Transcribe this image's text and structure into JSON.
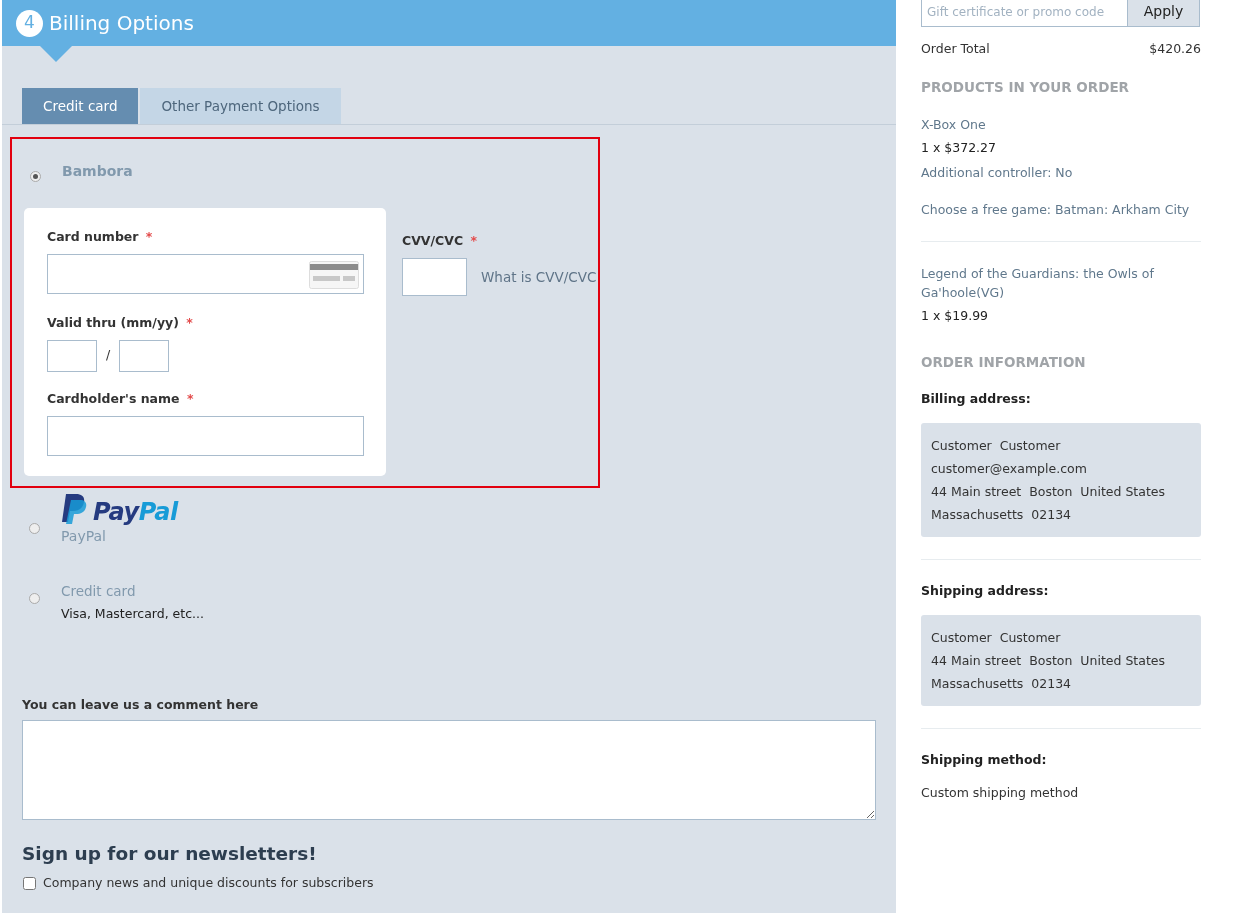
{
  "step": {
    "number": "4",
    "title": "Billing Options"
  },
  "tabs": [
    {
      "label": "Credit card",
      "selected": true
    },
    {
      "label": "Other Payment Options",
      "selected": false
    }
  ],
  "payment_methods": [
    {
      "kind": "form",
      "name": "Bambora",
      "selected": true,
      "highlighted": true,
      "card_number": {
        "label": "Card number",
        "required_mark": "*"
      },
      "valid_thru": {
        "label": "Valid thru (mm/yy)",
        "required_mark": "*",
        "separator": "/"
      },
      "cardholder": {
        "label": "Cardholder's name",
        "required_mark": "*"
      },
      "cvv": {
        "label": "CVV/CVC",
        "required_mark": "*",
        "help_link": "What is CVV/CVC"
      }
    },
    {
      "kind": "logo",
      "logo": [
        "Pay",
        "Pal"
      ],
      "name": "PayPal",
      "selected": false
    },
    {
      "kind": "plain",
      "name": "Credit card",
      "description": "Visa, Mastercard, etc...",
      "selected": false
    }
  ],
  "comment": {
    "label": "You can leave us a comment here"
  },
  "newsletter": {
    "title": "Sign up for our newsletters!",
    "options": [
      {
        "label": "Company news and unique discounts for subscribers",
        "checked": false
      }
    ]
  },
  "promo": {
    "placeholder": "Gift certificate or promo code",
    "button": "Apply"
  },
  "order_total": {
    "label": "Order Total",
    "value": "$420.26"
  },
  "products": {
    "heading": "PRODUCTS IN YOUR ORDER",
    "items": [
      {
        "name": "X-Box One",
        "quantity_price": "1 x $372.27",
        "options": [
          "Additional controller: No",
          "Choose a free game: Batman: Arkham City"
        ]
      },
      {
        "name": "Legend of the Guardians: the Owls of Ga'hoole(VG)",
        "quantity_price": "1 x $19.99"
      }
    ]
  },
  "order_info": {
    "heading": "ORDER INFORMATION",
    "sections": [
      {
        "kind": "address",
        "title": "Billing address:",
        "lines": [
          "Customer  Customer",
          "customer@example.com",
          "44 Main street  Boston  United States",
          "Massachusetts  02134"
        ]
      },
      {
        "kind": "address",
        "title": "Shipping address:",
        "lines": [
          "Customer  Customer",
          "44 Main street  Boston  United States",
          "Massachusetts  02134"
        ]
      },
      {
        "kind": "text",
        "title": "Shipping method:",
        "lines": [
          "Custom shipping method"
        ]
      }
    ]
  }
}
